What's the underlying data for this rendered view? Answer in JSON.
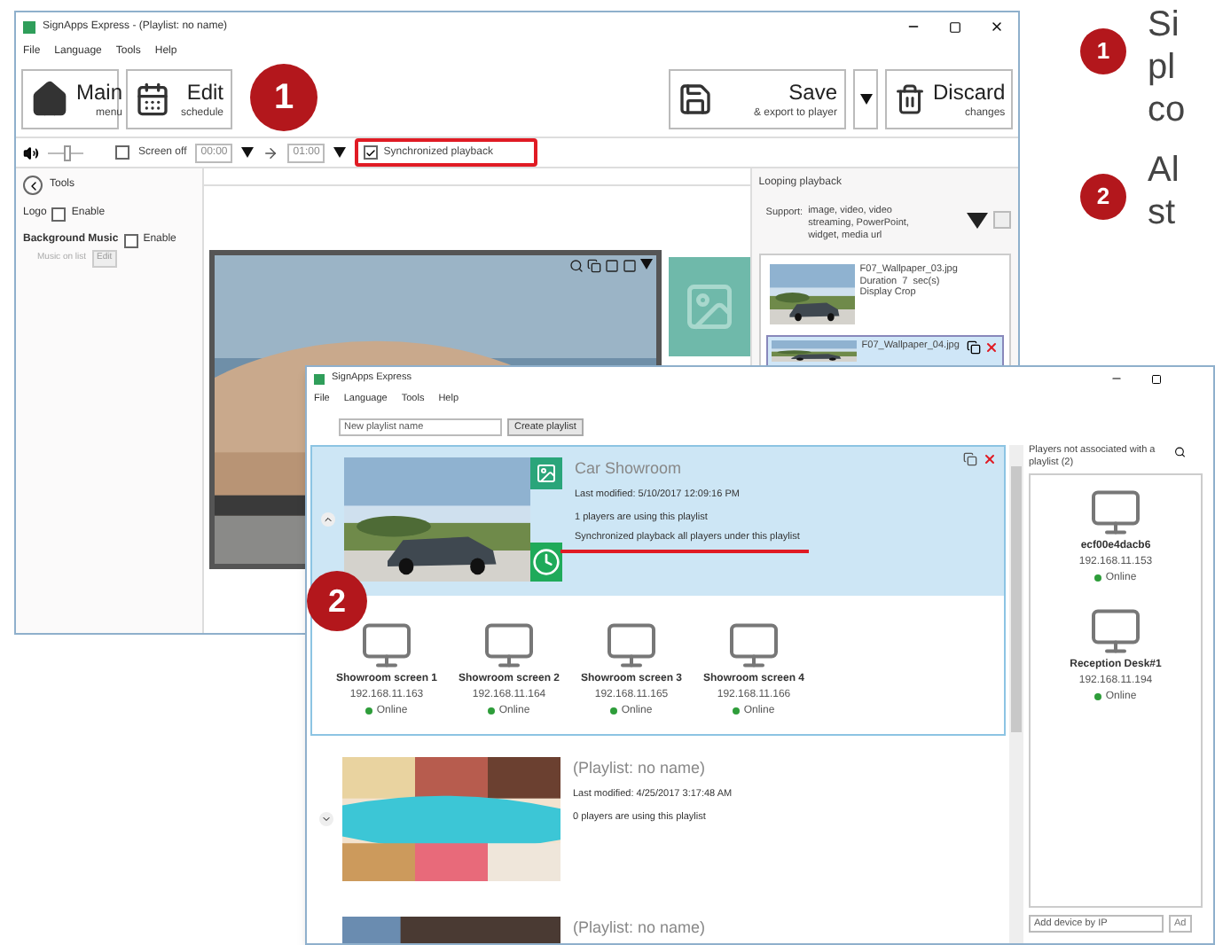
{
  "back_window": {
    "title": "SignApps Express - (Playlist: no name)",
    "menu": [
      "File",
      "Language",
      "Tools",
      "Help"
    ],
    "toolbar": [
      {
        "title": "Main",
        "subtitle": "menu",
        "kind": "home"
      },
      {
        "title": "Edit",
        "subtitle": "schedule",
        "kind": "calendar"
      }
    ],
    "toolbar_right": [
      {
        "title": "Save",
        "subtitle": "& export to player",
        "kind": "save"
      },
      {
        "title": "Discard",
        "subtitle": "changes",
        "kind": "trash"
      }
    ],
    "volume": {
      "level": 0.55
    },
    "screen_off": {
      "label": "Screen off",
      "checked": false,
      "from": "00:00",
      "to": "01:00"
    },
    "sync": {
      "label": "Synchronized playback",
      "checked": true,
      "highlighted": true
    },
    "tools": {
      "title": "Tools",
      "logo": {
        "label": "Logo",
        "option": "Enable",
        "checked": false
      },
      "music": {
        "label": "Background Music",
        "option": "Enable",
        "checked": false
      },
      "music_list": "Music on list",
      "edit_button": "Edit"
    },
    "looping": {
      "title": "Looping playback",
      "support_label": "Support:",
      "support_text": "image, video, video streaming, PowerPoint, widget, media url",
      "items": [
        {
          "name": "F07_Wallpaper_03.jpg",
          "duration": "Duration  7  sec(s)",
          "mode": "Display Crop",
          "selected": false
        },
        {
          "name": "F07_Wallpaper_04.jpg",
          "selected": true
        }
      ]
    }
  },
  "front_window": {
    "title": "SignApps Express",
    "menu": [
      "File",
      "Language",
      "Tools",
      "Help"
    ],
    "new_playlist": {
      "placeholder": "New playlist name"
    },
    "create_button": "Create playlist",
    "playlists": [
      {
        "name": "Car Showroom",
        "modified": "Last modified: 5/10/2017 12:09:16 PM",
        "usage": "1 players are using this playlist",
        "sync_note": "Synchronized playback all players under this playlist",
        "expanded": true,
        "selected": true,
        "players": [
          {
            "name": "Showroom screen 1",
            "ip": "192.168.11.163",
            "status": "Online"
          },
          {
            "name": "Showroom screen 2",
            "ip": "192.168.11.164",
            "status": "Online"
          },
          {
            "name": "Showroom screen 3",
            "ip": "192.168.11.165",
            "status": "Online"
          },
          {
            "name": "Showroom screen 4",
            "ip": "192.168.11.166",
            "status": "Online"
          }
        ]
      },
      {
        "name": "(Playlist: no name)",
        "modified": "Last modified: 4/25/2017 3:17:48 AM",
        "usage": "0 players are using this playlist",
        "expanded": false,
        "selected": false
      },
      {
        "name": "(Playlist: no name)",
        "selected": false
      }
    ],
    "unassigned": {
      "title": "Players not associated with a playlist (2)",
      "players": [
        {
          "name": "ecf00e4dacb6",
          "ip": "192.168.11.153",
          "status": "Online"
        },
        {
          "name": "Reception Desk#1",
          "ip": "192.168.11.194",
          "status": "Online"
        }
      ]
    },
    "add_device": {
      "placeholder": "Add device by IP"
    },
    "add_button": "Ad"
  },
  "screen_badges": [
    "1",
    "2"
  ],
  "notes": [
    {
      "number": "1",
      "lines": [
        "Si",
        "pl",
        "co"
      ]
    },
    {
      "number": "2",
      "lines": [
        "Al",
        "st"
      ]
    }
  ]
}
